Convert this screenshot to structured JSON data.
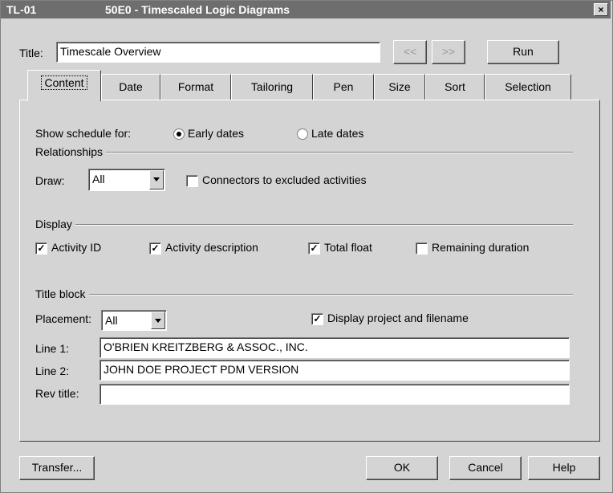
{
  "window": {
    "id": "TL-01",
    "title": "50E0 - Timescaled Logic Diagrams",
    "close": "×"
  },
  "header": {
    "title_label": "Title:",
    "title_value": "Timescale Overview",
    "prev_label": "<<",
    "next_label": ">>",
    "run_label": "Run"
  },
  "tabs": [
    {
      "label": "Content",
      "active": true
    },
    {
      "label": "Date"
    },
    {
      "label": "Format"
    },
    {
      "label": "Tailoring"
    },
    {
      "label": "Pen"
    },
    {
      "label": "Size"
    },
    {
      "label": "Sort"
    },
    {
      "label": "Selection"
    }
  ],
  "content": {
    "show_schedule_label": "Show  schedule for:",
    "early_dates": "Early dates",
    "late_dates": "Late dates",
    "relationships_group": "Relationships",
    "draw_label": "Draw:",
    "draw_value": "All",
    "connectors_label": "Connectors to excluded activities",
    "display_group": "Display",
    "activity_id": "Activity ID",
    "activity_description": "Activity description",
    "total_float": "Total float",
    "remaining_duration": "Remaining duration",
    "title_block_group": "Title block",
    "placement_label": "Placement:",
    "placement_value": "All",
    "display_project_label": "Display project and filename",
    "line1_label": "Line 1:",
    "line1_value": "O'BRIEN KREITZBERG & ASSOC., INC.",
    "line2_label": "Line 2:",
    "line2_value": "JOHN DOE PROJECT PDM VERSION",
    "rev_title_label": "Rev title:",
    "rev_title_value": ""
  },
  "footer": {
    "transfer_label": "Transfer...",
    "ok_label": "OK",
    "cancel_label": "Cancel",
    "help_label": "Help"
  }
}
